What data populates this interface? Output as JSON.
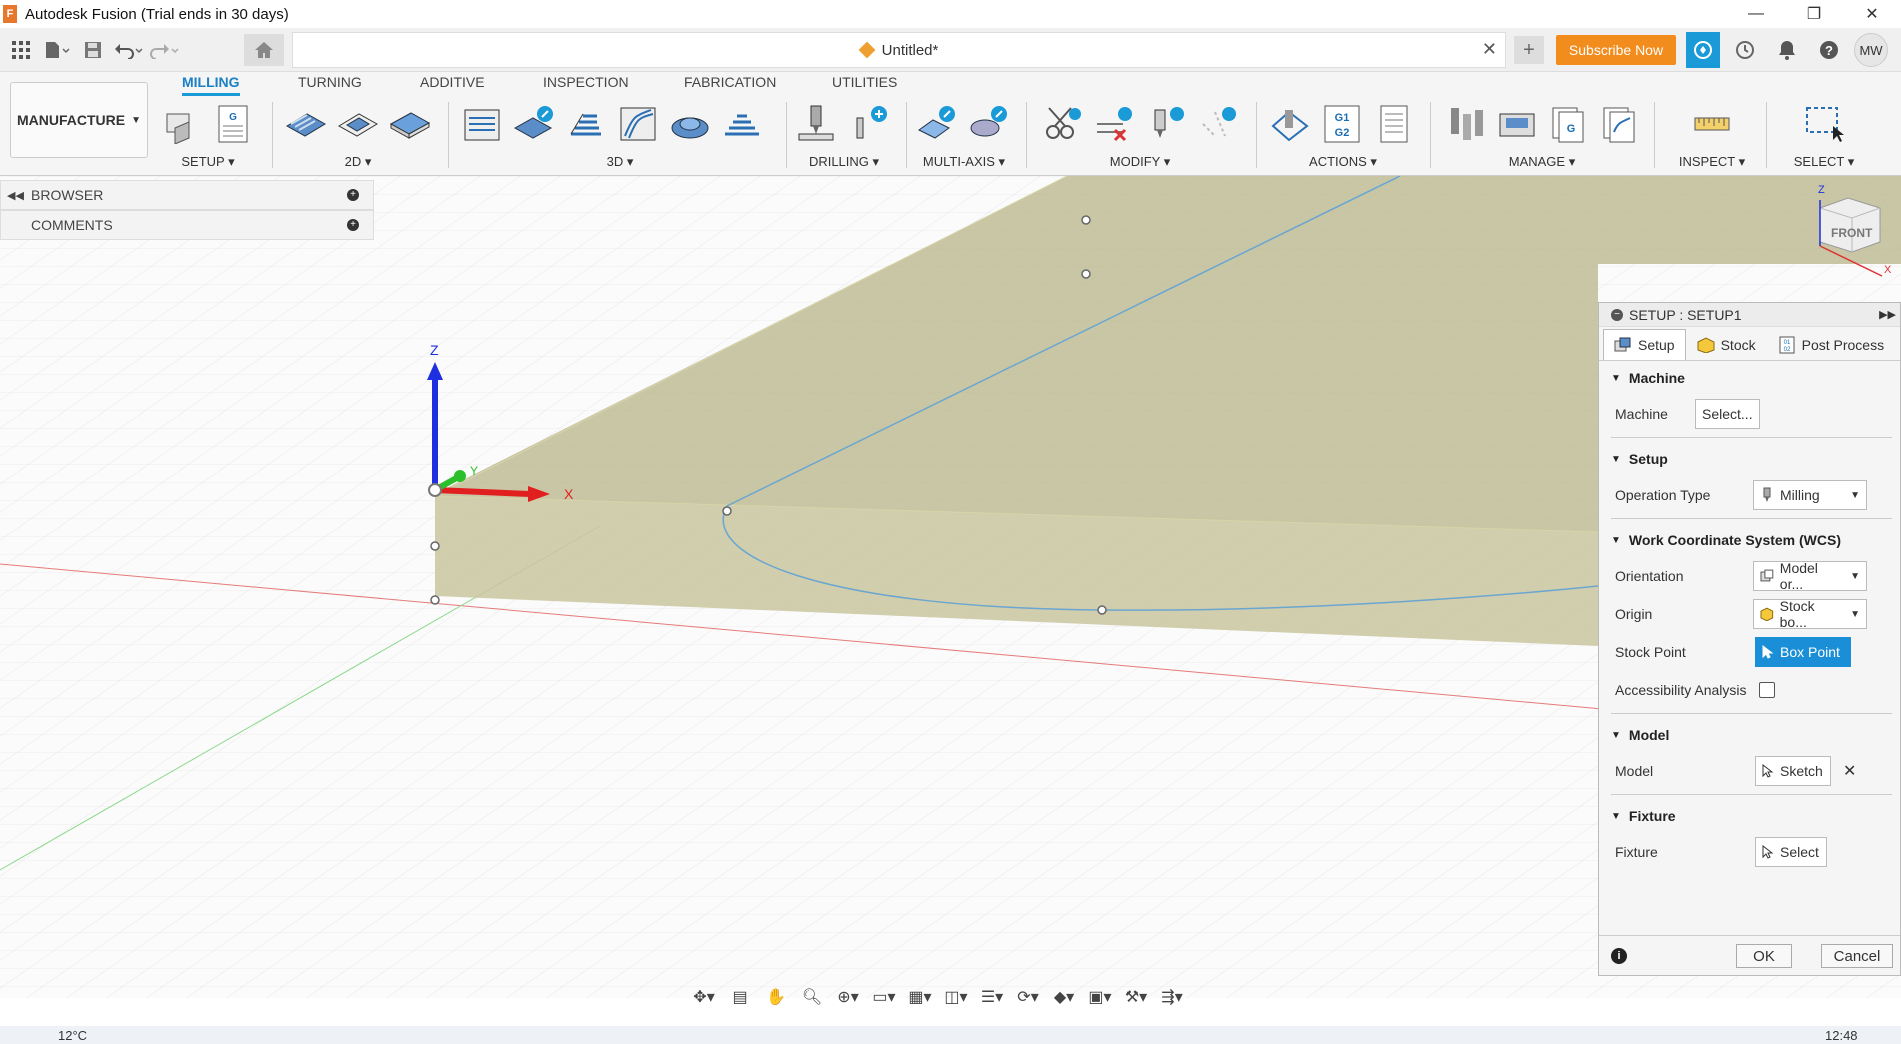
{
  "window": {
    "title": "Autodesk Fusion (Trial ends in 30 days)",
    "minimize": "—",
    "restore": "❐",
    "close": "✕"
  },
  "quickbar": {
    "document_title": "Untitled*",
    "close_tab": "✕",
    "new_tab": "+",
    "subscribe_label": "Subscribe Now",
    "user_initials": "MW"
  },
  "ribbon": {
    "workspace": "MANUFACTURE",
    "tabs": [
      "MILLING",
      "TURNING",
      "ADDITIVE",
      "INSPECTION",
      "FABRICATION",
      "UTILITIES"
    ],
    "groups": [
      "SETUP ▾",
      "2D ▾",
      "3D ▾",
      "DRILLING ▾",
      "MULTI-AXIS ▾",
      "MODIFY ▾",
      "ACTIONS ▾",
      "MANAGE ▾",
      "INSPECT ▾",
      "SELECT ▾"
    ]
  },
  "browser": {
    "browser_label": "BROWSER",
    "comments_label": "COMMENTS"
  },
  "axes": {
    "x": "X",
    "y": "Y",
    "z": "Z"
  },
  "viewcube": {
    "face": "FRONT",
    "z": "Z",
    "x": "X"
  },
  "setup_panel": {
    "title": "SETUP : SETUP1",
    "tabs": [
      "Setup",
      "Stock",
      "Post Process"
    ],
    "sections": {
      "machine": "Machine",
      "setup": "Setup",
      "wcs": "Work Coordinate System (WCS)",
      "model": "Model",
      "fixture": "Fixture"
    },
    "fields": {
      "machine_label": "Machine",
      "machine_value": "Select...",
      "operation_type_label": "Operation Type",
      "operation_type_value": "Milling",
      "orientation_label": "Orientation",
      "orientation_value": "Model or...",
      "origin_label": "Origin",
      "origin_value": "Stock bo...",
      "stock_point_label": "Stock Point",
      "stock_point_value": "Box Point",
      "accessibility_label": "Accessibility Analysis",
      "model_label": "Model",
      "model_value": "Sketch",
      "fixture_label": "Fixture",
      "fixture_value": "Select"
    },
    "ok_label": "OK",
    "cancel_label": "Cancel"
  },
  "taskbar": {
    "temperature": "12°C",
    "time": "12:48"
  },
  "colors": {
    "accent": "#1a9ad6",
    "subscribe": "#f28c1c",
    "stock_fill": "#b8b48a"
  }
}
